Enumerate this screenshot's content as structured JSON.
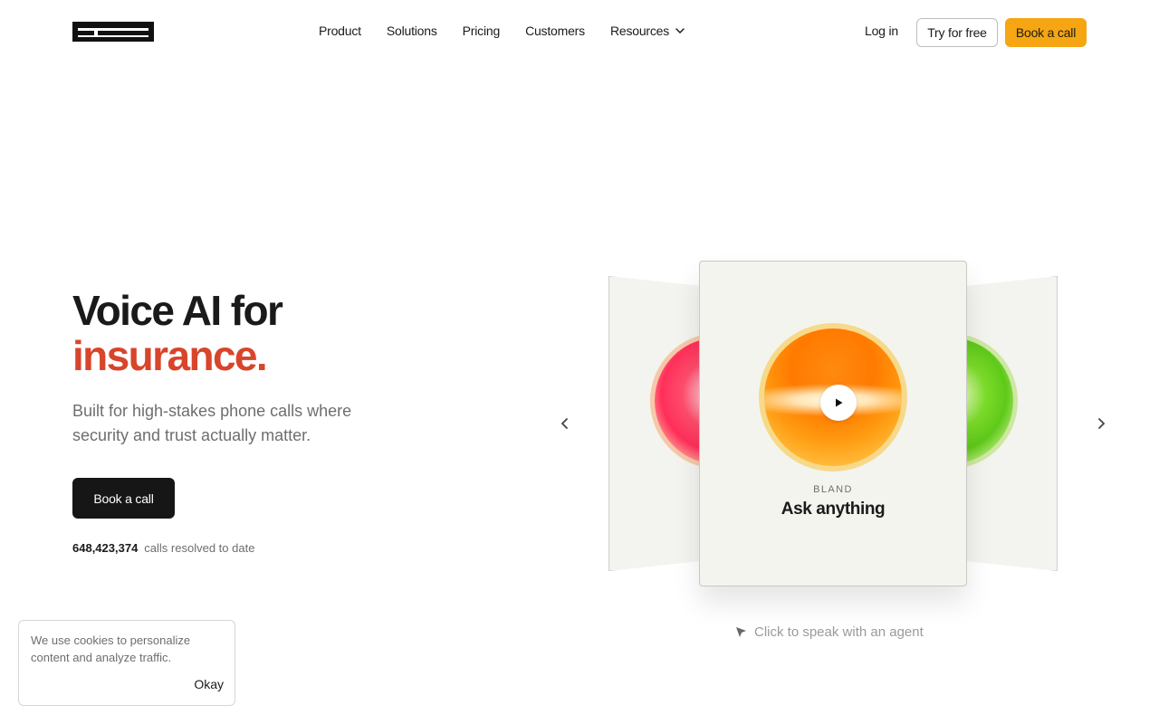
{
  "header": {
    "logo_alt": "bland",
    "nav": [
      {
        "label": "Product"
      },
      {
        "label": "Solutions"
      },
      {
        "label": "Pricing"
      },
      {
        "label": "Customers"
      },
      {
        "label": "Resources",
        "icon": "chevron-down-icon"
      }
    ],
    "login_label": "Log in",
    "try_label": "Try for free",
    "book_label": "Book a call"
  },
  "hero": {
    "title_line1": "Voice AI for",
    "title_line2": "insurance.",
    "subtitle": "Built for high-stakes phone calls where security and trust actually matter.",
    "cta_label": "Book a call",
    "stat_number": "648,423,374",
    "stat_label": "calls resolved to date"
  },
  "carousel": {
    "brand": "BLAND",
    "title": "Ask anything",
    "hint": "Click to speak with an agent",
    "prev_icon": "chevron-left-icon",
    "next_icon": "chevron-right-icon",
    "play_icon": "play-icon"
  },
  "cookie": {
    "text": "We use cookies to personalize content and analyze traffic.",
    "ok_label": "Okay"
  },
  "colors": {
    "accent_orange": "#f5a612",
    "headline_accent": "#d8452a",
    "dark_button": "#161616"
  }
}
